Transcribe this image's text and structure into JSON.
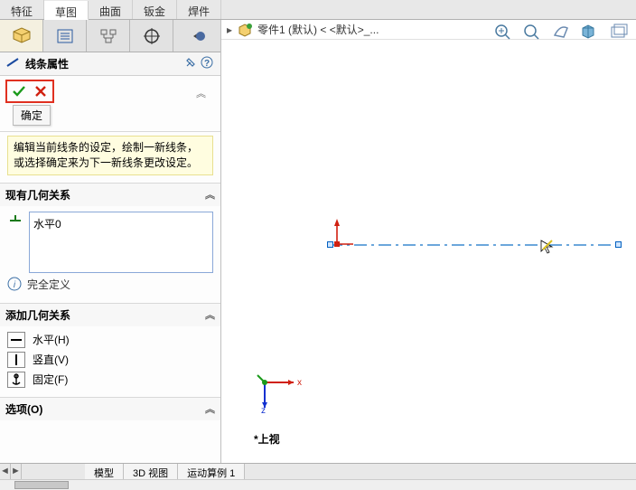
{
  "ribbon": {
    "tabs": [
      "特征",
      "草图",
      "曲面",
      "钣金",
      "焊件"
    ],
    "active_index": 1
  },
  "breadcrumb": {
    "text": "零件1 (默认) < <默认>_..."
  },
  "property_manager": {
    "title": "线条属性",
    "ok_tooltip": "确定",
    "message": "编辑当前线条的设定，绘制一新线条，或选择确定来为下一新线条更改设定。",
    "existing_relations": {
      "header": "现有几何关系",
      "items": [
        "水平0"
      ],
      "status_text": "完全定义"
    },
    "add_relations": {
      "header": "添加几何关系",
      "items": [
        {
          "label": "水平(H)",
          "icon": "horiz"
        },
        {
          "label": "竖直(V)",
          "icon": "vert"
        },
        {
          "label": "固定(F)",
          "icon": "fix"
        }
      ]
    },
    "options": {
      "header": "选项(O)"
    }
  },
  "viewport": {
    "view_label": "*上视",
    "triad_labels": {
      "x": "x",
      "z": "z"
    }
  },
  "bottom_tabs": [
    "模型",
    "3D 视图",
    "运动算例 1"
  ]
}
